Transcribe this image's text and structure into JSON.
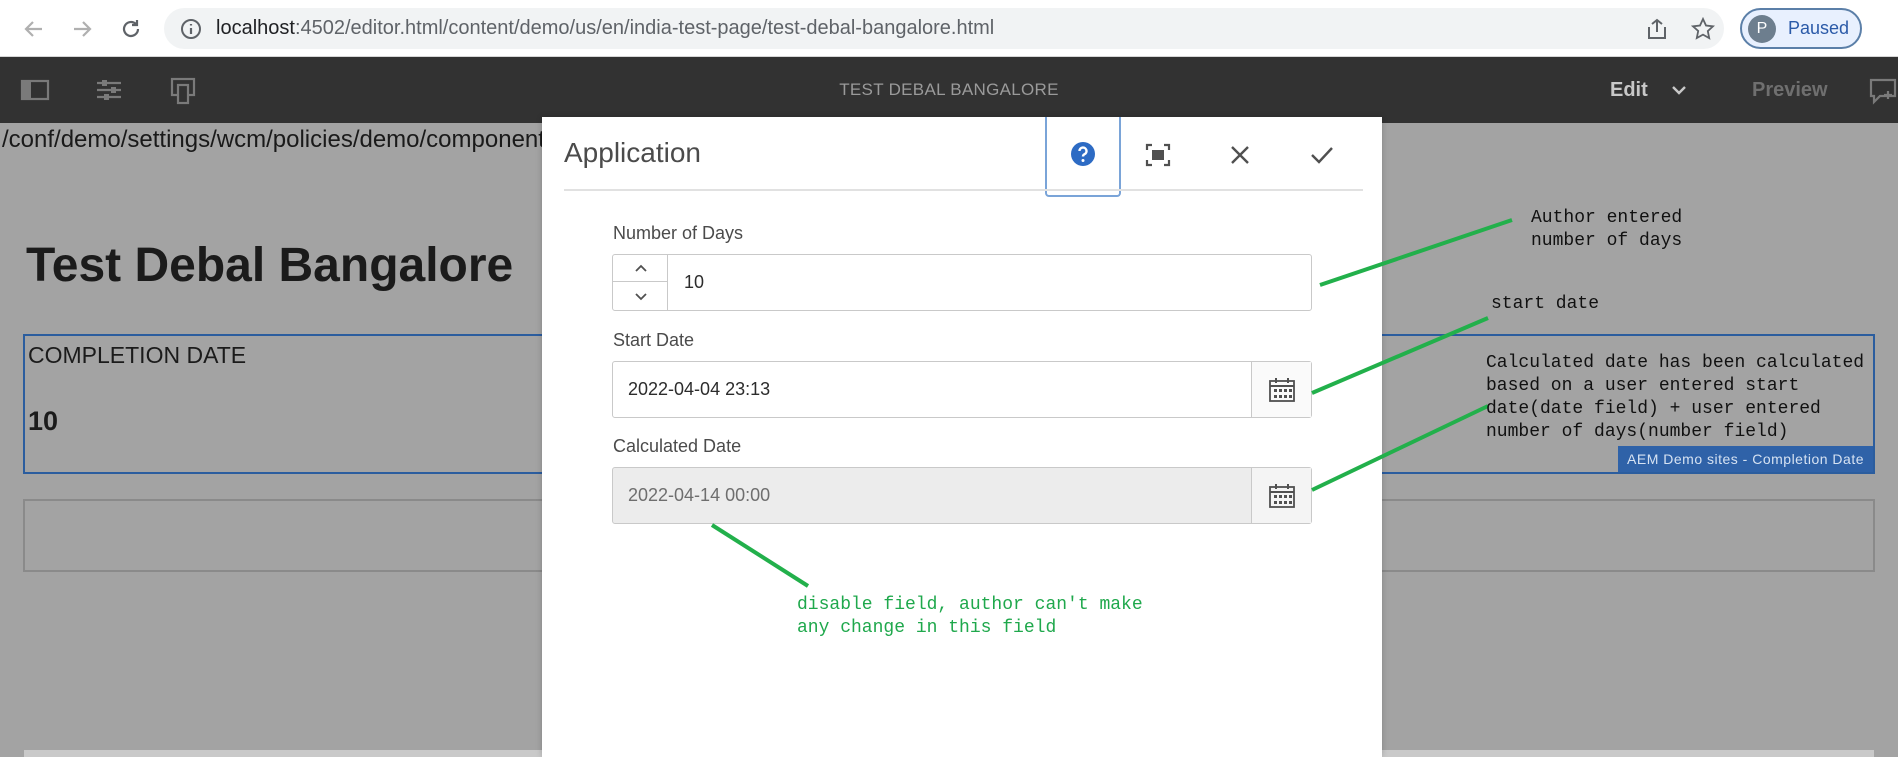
{
  "browser": {
    "url_host": "localhost",
    "url_rest": ":4502/editor.html/content/demo/us/en/india-test-page/test-debal-bangalore.html",
    "profile_initial": "P",
    "profile_status": "Paused",
    "icons": [
      "back-arrow-icon",
      "forward-arrow-icon",
      "reload-icon",
      "info-icon",
      "share-icon",
      "star-icon"
    ]
  },
  "editor_bar": {
    "page_title": "TEST DEBAL BANGALORE",
    "mode_label": "Edit",
    "preview_label": "Preview",
    "icons": [
      "side-panel-icon",
      "page-properties-icon",
      "emulator-icon",
      "chevron-down-icon",
      "annotate-icon"
    ]
  },
  "page": {
    "policy_path": "/conf/demo/settings/wcm/policies/demo/component",
    "heading": "Test Debal Bangalore",
    "component": {
      "label": "COMPLETION DATE",
      "value": "10",
      "badge": "AEM Demo sites - Completion Date"
    }
  },
  "dialog": {
    "title": "Application",
    "icons": [
      "help-icon",
      "fullscreen-icon",
      "close-icon",
      "check-icon"
    ],
    "fields": {
      "days": {
        "label": "Number of Days",
        "value": "10"
      },
      "start": {
        "label": "Start Date",
        "value": "2022-04-04 23:13"
      },
      "calculated": {
        "label": "Calculated Date",
        "value": "2022-04-14 00:00",
        "disabled": true
      }
    }
  },
  "annotations": {
    "author_days": "Author entered\nnumber of days",
    "start_date": "start date",
    "calculated": "Calculated date has been calculated\nbased on a user entered start\ndate(date field) + user entered\nnumber of days(number field)",
    "disabled": "disable field, author can't make\nany change in this field",
    "line_color": "#22b04b"
  },
  "colors": {
    "editor_bar": "#323232",
    "page_overlay": "#a3a3a3",
    "selection_blue": "#2b5d9e",
    "help_blue": "#2d6bc4"
  }
}
